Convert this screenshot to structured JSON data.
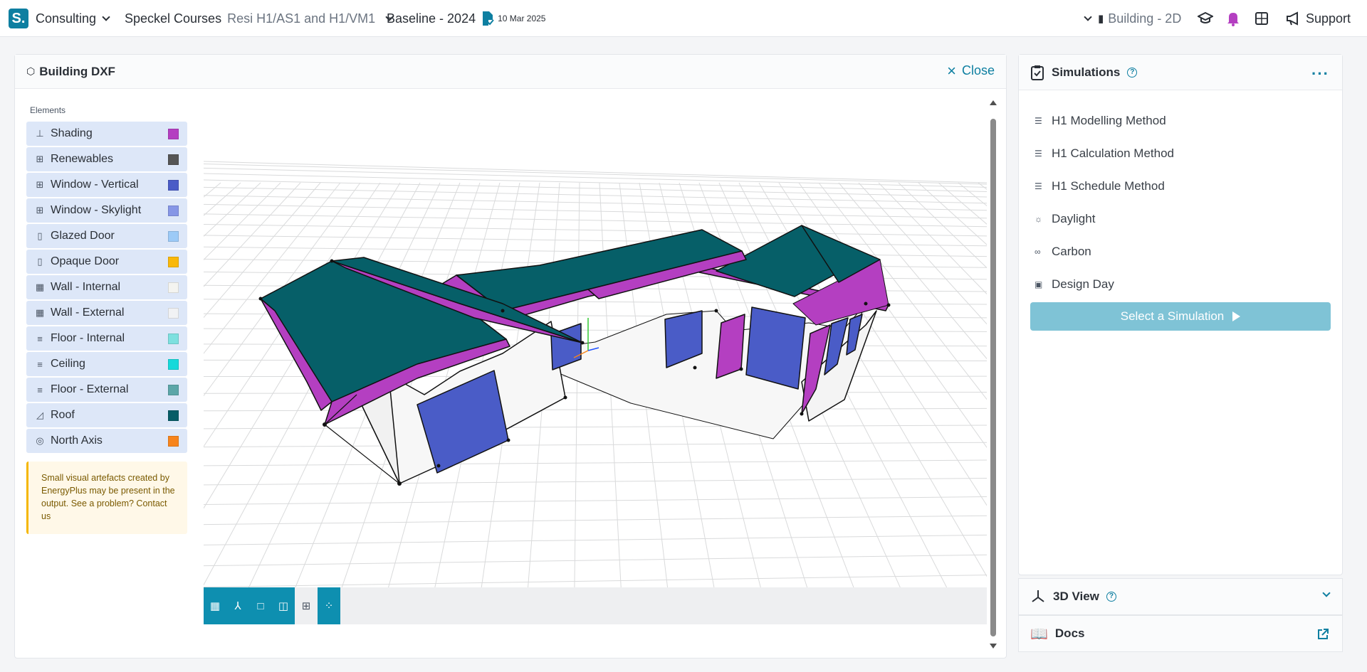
{
  "topbar": {
    "logo": "S.",
    "org": "Consulting",
    "project_label": "Speckel Courses",
    "project_name": "Resi H1/AS1 and H1/VM1",
    "baseline": "Baseline - 2024",
    "date": "10 Mar 2025",
    "view_mode": "Building - 2D",
    "support": "Support"
  },
  "main_panel": {
    "title": "Building DXF",
    "close_label": "Close",
    "elements_label": "Elements",
    "legend": [
      {
        "label": "Shading",
        "icon": "shading-icon",
        "glyph": "⊥",
        "color": "#b43fc1"
      },
      {
        "label": "Renewables",
        "icon": "solar-panel-icon",
        "glyph": "⊞",
        "color": "#555555"
      },
      {
        "label": "Window - Vertical",
        "icon": "window-icon",
        "glyph": "⊞",
        "color": "#4a5cc7"
      },
      {
        "label": "Window - Skylight",
        "icon": "window-icon",
        "glyph": "⊞",
        "color": "#8696e6"
      },
      {
        "label": "Glazed Door",
        "icon": "door-icon",
        "glyph": "▯",
        "color": "#9ccaf7"
      },
      {
        "label": "Opaque Door",
        "icon": "door-icon",
        "glyph": "▯",
        "color": "#f9b80a"
      },
      {
        "label": "Wall - Internal",
        "icon": "wall-icon",
        "glyph": "▦",
        "color": "#f4f4f0"
      },
      {
        "label": "Wall - External",
        "icon": "wall-icon",
        "glyph": "▦",
        "color": "#f1f2f4"
      },
      {
        "label": "Floor - Internal",
        "icon": "floor-icon",
        "glyph": "≡",
        "color": "#7de0df"
      },
      {
        "label": "Ceiling",
        "icon": "ceiling-icon",
        "glyph": "≡",
        "color": "#16d9da"
      },
      {
        "label": "Floor - External",
        "icon": "floor-icon",
        "glyph": "≡",
        "color": "#5ca6a8"
      },
      {
        "label": "Roof",
        "icon": "roof-icon",
        "glyph": "◿",
        "color": "#075d67"
      },
      {
        "label": "North Axis",
        "icon": "compass-icon",
        "glyph": "◎",
        "color": "#f7841c"
      }
    ],
    "notice": "Small visual artefacts created by EnergyPlus may be present in the output. See a problem? Contact us"
  },
  "simulations": {
    "title": "Simulations",
    "items": [
      {
        "label": "H1 Modelling Method",
        "icon": "list-icon",
        "glyph": "☰"
      },
      {
        "label": "H1 Calculation Method",
        "icon": "list-icon",
        "glyph": "☰"
      },
      {
        "label": "H1 Schedule Method",
        "icon": "list-icon",
        "glyph": "☰"
      },
      {
        "label": "Daylight",
        "icon": "sun-icon",
        "glyph": "☼"
      },
      {
        "label": "Carbon",
        "icon": "carbon-icon",
        "glyph": "∞"
      },
      {
        "label": "Design Day",
        "icon": "calendar-icon",
        "glyph": "▣"
      }
    ],
    "select_label": "Select a Simulation"
  },
  "view3d": {
    "title": "3D View"
  },
  "docs": {
    "title": "Docs"
  },
  "colors": {
    "accent": "#0e7fa1",
    "roof": "#065f68",
    "shading": "#b43fc1",
    "window": "#4a5cc7"
  }
}
